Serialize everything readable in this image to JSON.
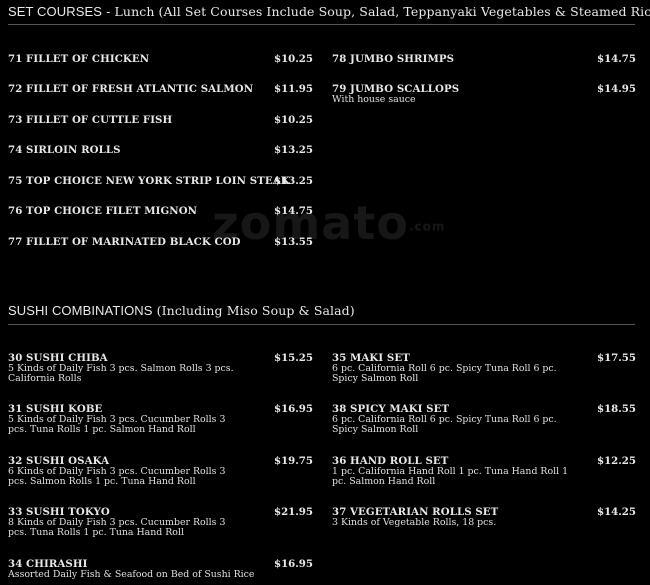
{
  "set_courses": {
    "title_lead": "SET COURSES",
    "title_rest": " - Lunch (All Set Courses Include Soup, Salad, Teppanyaki Vegetables & Steamed Rice)",
    "left": [
      {
        "name": "71 FILLET OF CHICKEN",
        "price": "$10.25"
      },
      {
        "name": "72 FILLET OF FRESH ATLANTIC SALMON",
        "price": "$11.95"
      },
      {
        "name": "73 FILLET OF CUTTLE FISH",
        "price": "$10.25"
      },
      {
        "name": "74 SIRLOIN ROLLS",
        "price": "$13.25"
      },
      {
        "name": "75 TOP CHOICE NEW YORK STRIP LOIN STEAK",
        "price": "$13.25"
      },
      {
        "name": "76 TOP CHOICE FILET MIGNON",
        "price": "$14.75"
      },
      {
        "name": "77 FILLET OF MARINATED BLACK COD",
        "price": "$13.55"
      }
    ],
    "right": [
      {
        "name": "78 JUMBO SHRIMPS",
        "price": "$14.75"
      },
      {
        "name": "79 JUMBO SCALLOPS",
        "desc": "With house sauce",
        "price": "$14.95"
      }
    ]
  },
  "sushi": {
    "title_lead": "SUSHI COMBINATIONS",
    "title_rest": " (Including Miso Soup & Salad)",
    "left": [
      {
        "name": "30 SUSHI CHIBA",
        "desc": "5 Kinds of Daily Fish 3 pcs. Salmon Rolls 3 pcs. California Rolls",
        "price": "$15.25"
      },
      {
        "name": "31 SUSHI KOBE",
        "desc": "5 Kinds of Daily Fish 3 pcs. Cucumber Rolls 3 pcs. Tuna Rolls 1 pc. Salmon Hand Roll",
        "price": "$16.95"
      },
      {
        "name": "32 SUSHI OSAKA",
        "desc": "6 Kinds of Daily Fish 3 pcs. Cucumber Rolls 3 pcs. Salmon Rolls 1 pc. Tuna Hand Roll",
        "price": "$19.75"
      },
      {
        "name": "33 SUSHI TOKYO",
        "desc": "8 Kinds of Daily Fish 3 pcs. Cucumber Rolls 3 pcs. Tuna Rolls 1 pc. Tuna Hand Roll",
        "price": "$21.95"
      },
      {
        "name": "34 CHIRASHI",
        "desc": "Assorted Daily Fish & Seafood on Bed of Sushi Rice",
        "price": "$16.95"
      }
    ],
    "right": [
      {
        "name": "35 MAKI SET",
        "desc": "6 pc. California Roll 6 pc. Spicy Tuna Roll 6 pc. Spicy Salmon Roll",
        "price": "$17.55"
      },
      {
        "name": "38 SPICY MAKI SET",
        "desc": "6 pc. California Roll 6 pc. Spicy Tuna Roll 6 pc. Spicy Salmon Roll",
        "price": "$18.55"
      },
      {
        "name": "36 HAND ROLL SET",
        "desc": "1 pc. California Hand Roll 1 pc. Tuna Hand Roll 1 pc. Salmon Hand Roll",
        "price": "$12.25"
      },
      {
        "name": "37 VEGETARIAN ROLLS SET",
        "desc": "3 Kinds of Vegetable Rolls, 18 pcs.",
        "price": "$14.25"
      }
    ]
  },
  "watermark": {
    "text": "zomato",
    "suffix": ".com"
  }
}
